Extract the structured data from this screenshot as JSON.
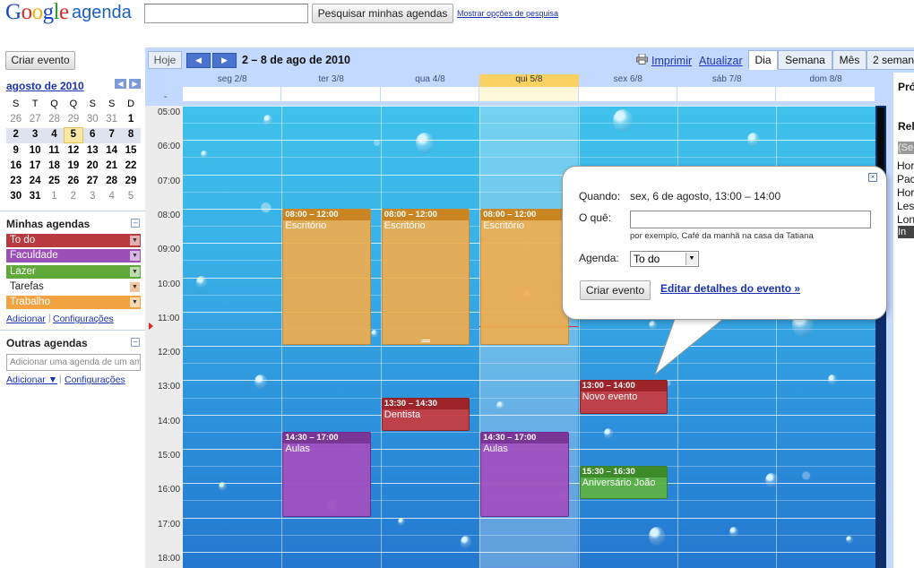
{
  "header": {
    "search_button": "Pesquisar minhas agendas",
    "search_options_link": "Mostrar opções de pesquisa"
  },
  "sidebar": {
    "create_button": "Criar evento",
    "mini_calendar": {
      "title": "agosto de 2010",
      "weekdays": [
        "S",
        "T",
        "Q",
        "Q",
        "S",
        "S",
        "D"
      ],
      "weeks": [
        [
          "26",
          "27",
          "28",
          "29",
          "30",
          "31",
          "1"
        ],
        [
          "2",
          "3",
          "4",
          "5",
          "6",
          "7",
          "8"
        ],
        [
          "9",
          "10",
          "11",
          "12",
          "13",
          "14",
          "15"
        ],
        [
          "16",
          "17",
          "18",
          "19",
          "20",
          "21",
          "22"
        ],
        [
          "23",
          "24",
          "25",
          "26",
          "27",
          "28",
          "29"
        ],
        [
          "30",
          "31",
          "1",
          "2",
          "3",
          "4",
          "5"
        ]
      ],
      "today": "5"
    },
    "my_calendars_title": "Minhas agendas",
    "my_calendars": [
      {
        "label": "To do",
        "color": "#b83a3e"
      },
      {
        "label": "Faculdade",
        "color": "#9b4fb7"
      },
      {
        "label": "Lazer",
        "color": "#5fa83a"
      },
      {
        "label": "Tarefas",
        "color": "#ffffff"
      },
      {
        "label": "Trabalho",
        "color": "#f2a240"
      }
    ],
    "add_link": "Adicionar",
    "settings_link": "Configurações",
    "other_calendars_title": "Outras agendas",
    "other_calendars_placeholder": "Adicionar uma agenda de um ami",
    "add_link_2": "Adicionar ▼",
    "settings_link_2": "Configurações"
  },
  "toolbar": {
    "today": "Hoje",
    "date_range": "2 – 8 de ago de 2010",
    "print": "Imprimir",
    "refresh": "Atualizar",
    "views": [
      "Dia",
      "Semana",
      "Mês",
      "2 seman"
    ]
  },
  "days": [
    "seg 2/8",
    "ter 3/8",
    "qua 4/8",
    "qui 5/8",
    "sex 6/8",
    "sáb 7/8",
    "dom 8/8"
  ],
  "allday_marker": "-",
  "hours": [
    "05:00",
    "06:00",
    "07:00",
    "08:00",
    "09:00",
    "10:00",
    "11:00",
    "12:00",
    "13:00",
    "14:00",
    "15:00",
    "16:00",
    "17:00",
    "18:00"
  ],
  "events": [
    {
      "time": "08:00 – 12:00",
      "title": "Escritório",
      "color": "orange"
    },
    {
      "time": "08:00 – 12:00",
      "title": "Escritório",
      "color": "orange"
    },
    {
      "time": "08:00 – 12:00",
      "title": "Escritório",
      "color": "orange"
    },
    {
      "time": "13:30 – 14:30",
      "title": "Dentista",
      "color": "red"
    },
    {
      "time": "13:00 – 14:00",
      "title": "Novo evento",
      "color": "red"
    },
    {
      "time": "14:30 – 17:00",
      "title": "Aulas",
      "color": "purple"
    },
    {
      "time": "14:30 – 17:00",
      "title": "Aulas",
      "color": "purple"
    },
    {
      "time": "15:30 – 16:30",
      "title": "Aniversário João",
      "color": "green"
    }
  ],
  "popup": {
    "when_label": "Quando:",
    "when_value": "sex, 6 de agosto, 13:00 – 14:00",
    "what_label": "O quê:",
    "what_hint": "por exemplo, Café da manhã na casa da Tatiana",
    "calendar_label": "Agenda:",
    "calendar_value": "To do",
    "create_button": "Criar evento",
    "edit_link": "Editar detalhes do evento »"
  },
  "right_panel": {
    "heading1": "Pró",
    "heading2": "Rel",
    "pill1": "(Se",
    "lines": [
      "Hor",
      "Pac",
      "Hor",
      "Les",
      "Lon"
    ],
    "pill2": "In"
  }
}
